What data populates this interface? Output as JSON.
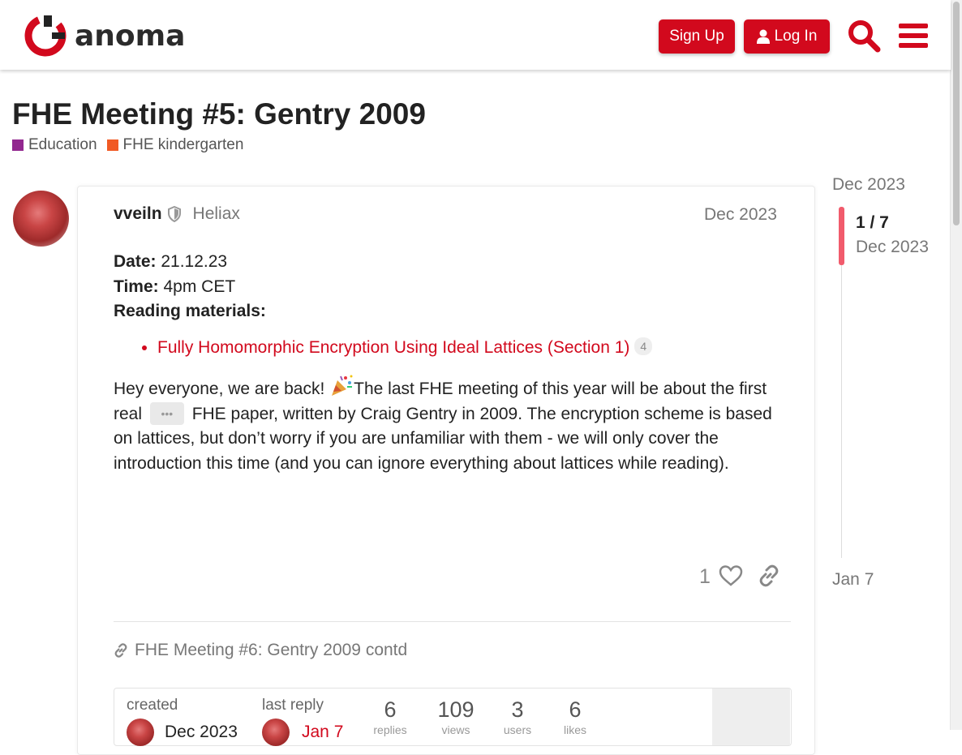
{
  "header": {
    "logo_text": "anoma",
    "signup_label": "Sign Up",
    "login_label": "Log In",
    "brand_color": "#d2091d"
  },
  "topic": {
    "title": "FHE Meeting #5: Gentry 2009",
    "categories": [
      {
        "label": "Education",
        "color": "#92278f"
      },
      {
        "label": "FHE kindergarten",
        "color": "#f7941d"
      }
    ]
  },
  "post": {
    "author": "vveiln",
    "group": "Heliax",
    "date": "Dec 2023",
    "date_label": "Date:",
    "date_value": " 21.12.23",
    "time_label": "Time:",
    "time_value": " 4pm CET",
    "reading_label": "Reading materials:",
    "link_text": "Fully Homomorphic Encryption Using Ideal Lattices (Section 1)",
    "link_clicks": "4",
    "para_1": "Hey everyone, we are back! ",
    "para_2": "The last FHE meeting of this year will be about the first real ",
    "para_3": " FHE paper, written by Craig Gentry in 2009. The encryption scheme is based on lattices, but don’t worry if you are unfamiliar with them - we will only cover the introduction this time (and you can ignore everything about lattices while reading).",
    "likes": "1",
    "linked_topic": "FHE Meeting #6: Gentry 2009 contd"
  },
  "topic_map": {
    "created_label": "created",
    "created_date": "Dec 2023",
    "last_reply_label": "last reply",
    "last_reply_date": "Jan 7",
    "stats": [
      {
        "value": "6",
        "label": "replies"
      },
      {
        "value": "109",
        "label": "views"
      },
      {
        "value": "3",
        "label": "users"
      },
      {
        "value": "6",
        "label": "likes"
      }
    ]
  },
  "timeline": {
    "top_date": "Dec 2023",
    "position": "1 / 7",
    "current_date": "Dec 2023",
    "bottom_date": "Jan 7"
  }
}
